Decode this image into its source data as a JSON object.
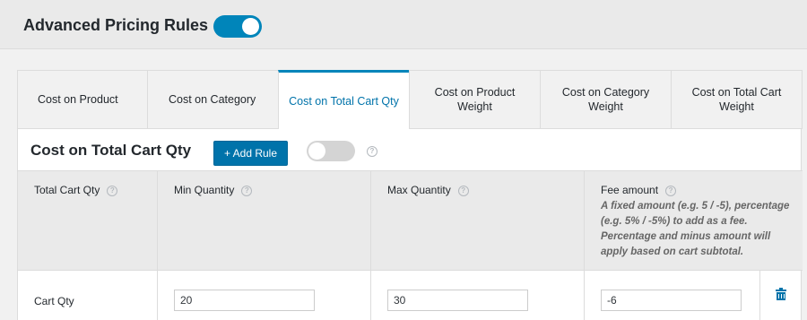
{
  "header": {
    "title": "Advanced Pricing Rules",
    "toggle_state": "on"
  },
  "tabs": [
    {
      "label": "Cost on Product",
      "active": false
    },
    {
      "label": "Cost on Category",
      "active": false
    },
    {
      "label": "Cost on Total Cart Qty",
      "active": true
    },
    {
      "label": "Cost on Product Weight",
      "active": false
    },
    {
      "label": "Cost on Category Weight",
      "active": false
    },
    {
      "label": "Cost on Total Cart Weight",
      "active": false
    }
  ],
  "section": {
    "title": "Cost on Total Cart Qty",
    "add_button": "+ Add Rule",
    "toggle_state": "off"
  },
  "table": {
    "columns": [
      {
        "label": "Total Cart Qty"
      },
      {
        "label": "Min Quantity"
      },
      {
        "label": "Max Quantity"
      },
      {
        "label": "Fee amount",
        "description": "A fixed amount (e.g. 5 / -5), percentage (e.g. 5% / -5%) to add as a fee. Percentage and minus amount will apply based on cart subtotal."
      }
    ],
    "rows": [
      {
        "label": "Cart Qty",
        "min": "20",
        "max": "30",
        "fee": "-6"
      }
    ]
  },
  "icons": {
    "help": "help-circle-icon",
    "delete": "trash-icon"
  },
  "colors": {
    "accent": "#0085ba",
    "button": "#0073aa"
  }
}
